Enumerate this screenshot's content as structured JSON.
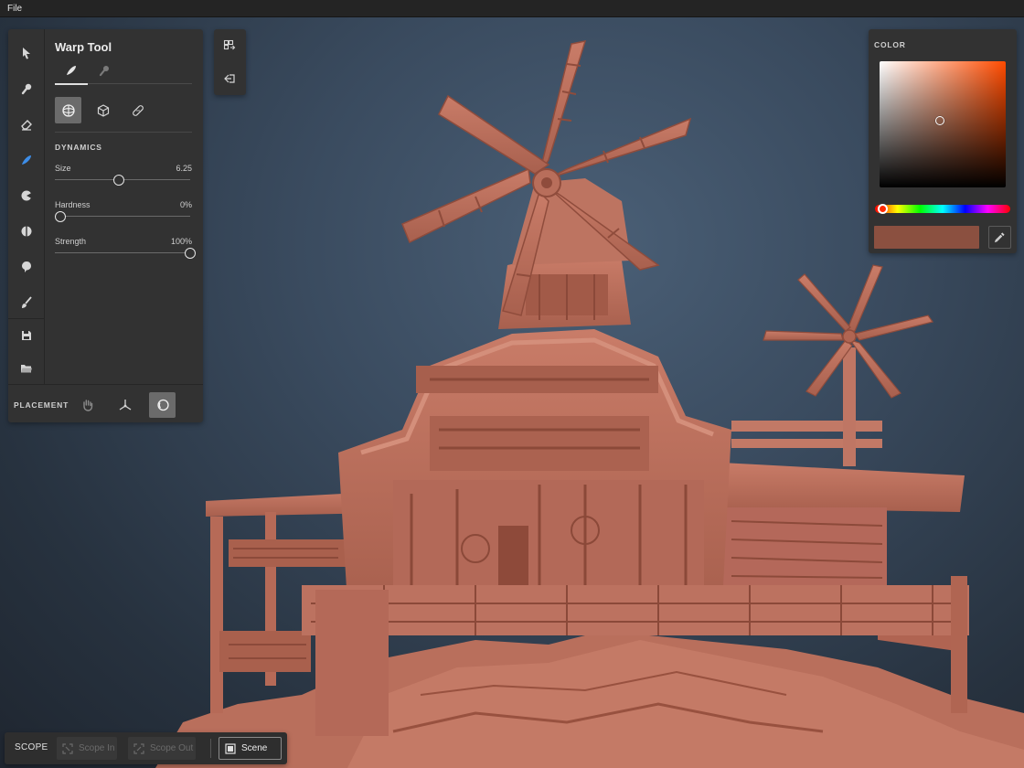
{
  "menu": {
    "file": "File"
  },
  "tool_panel": {
    "title": "Warp Tool",
    "dynamics_label": "DYNAMICS",
    "sliders": [
      {
        "label": "Size",
        "value": "6.25",
        "fraction": 0.45
      },
      {
        "label": "Hardness",
        "value": "0%",
        "fraction": 0.0
      },
      {
        "label": "Strength",
        "value": "100%",
        "fraction": 1.0
      }
    ],
    "placement_label": "PLACEMENT"
  },
  "color_panel": {
    "title": "COLOR",
    "current_color": "#8b5040",
    "saturation": 0.48,
    "value": 0.53,
    "hue_fraction": 0.02
  },
  "scope_bar": {
    "label": "SCOPE",
    "scope_in": "Scope In",
    "scope_out": "Scope Out",
    "scene": "Scene"
  },
  "accent_color": "#3d8de8"
}
